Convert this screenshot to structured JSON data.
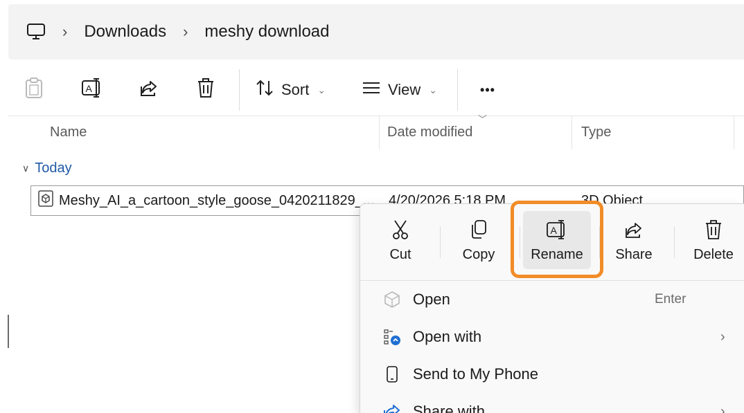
{
  "breadcrumb": {
    "root_icon": "computer-icon",
    "separator": "›",
    "items": [
      "Downloads",
      "meshy download"
    ]
  },
  "toolbar": {
    "paste_icon": "paste-icon",
    "rename_icon": "rename-icon",
    "share_icon": "share-icon",
    "delete_icon": "delete-icon",
    "sort_label": "Sort",
    "view_label": "View",
    "more_label": "•••"
  },
  "columns": {
    "name": "Name",
    "date": "Date modified",
    "type": "Type"
  },
  "group": {
    "label": "Today"
  },
  "file": {
    "name": "Meshy_AI_a_cartoon_style_goose_0420211829_...",
    "date": "4/20/2026 5:18 PM",
    "type": "3D Object"
  },
  "context_menu": {
    "actions": [
      {
        "label": "Cut",
        "icon": "cut-icon"
      },
      {
        "label": "Copy",
        "icon": "copy-icon"
      },
      {
        "label": "Rename",
        "icon": "rename-icon"
      },
      {
        "label": "Share",
        "icon": "share-icon"
      },
      {
        "label": "Delete",
        "icon": "delete-icon"
      }
    ],
    "items": [
      {
        "label": "Open",
        "hint": "Enter",
        "icon": "3d-object-icon"
      },
      {
        "label": "Open with",
        "arrow": "›",
        "icon": "open-with-icon"
      },
      {
        "label": "Send to My Phone",
        "icon": "phone-icon"
      },
      {
        "label": "Share with",
        "arrow": "›",
        "icon": "share-icon"
      }
    ]
  },
  "colors": {
    "highlight": "#f28c28",
    "group_link": "#1e5aa8"
  }
}
